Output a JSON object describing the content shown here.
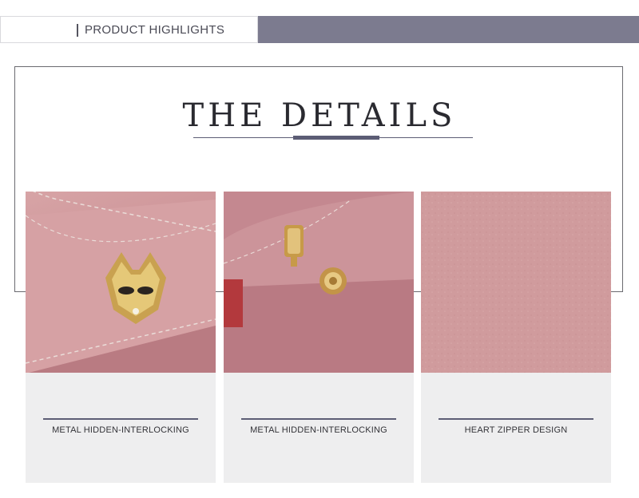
{
  "banner": {
    "heading": "PRODUCT HIGHLIGHTS"
  },
  "title": "THE DETAILS",
  "details": [
    {
      "caption": "METAL HIDDEN-INTERLOCKING",
      "icon": "fox-clasp-photo"
    },
    {
      "caption": "METAL HIDDEN-INTERLOCKING",
      "icon": "snap-button-photo"
    },
    {
      "caption": "HEART ZIPPER DESIGN",
      "icon": "leather-texture-photo"
    }
  ],
  "colors": {
    "accent": "#7c7b8f",
    "rule": "#5c5d75",
    "leather_pink": "#cf9799",
    "caption_bg": "#eeeeef"
  }
}
